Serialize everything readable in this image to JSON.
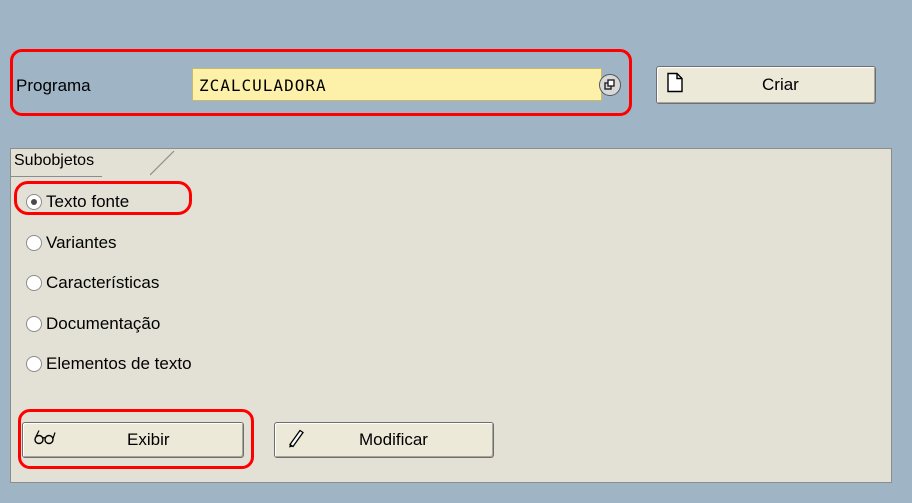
{
  "header": {
    "program_label": "Programa",
    "program_value": "ZCALCULADORA",
    "create_label": "Criar"
  },
  "subobjects": {
    "title": "Subobjetos",
    "options": [
      {
        "label": "Texto fonte",
        "selected": true
      },
      {
        "label": "Variantes",
        "selected": false
      },
      {
        "label": "Características",
        "selected": false
      },
      {
        "label": "Documentação",
        "selected": false
      },
      {
        "label": "Elementos de texto",
        "selected": false
      }
    ]
  },
  "actions": {
    "display_label": "Exibir",
    "modify_label": "Modificar"
  },
  "icons": {
    "create": "new-document-icon",
    "display": "glasses-icon",
    "modify": "pencil-icon",
    "search_help": "search-help-icon"
  },
  "colors": {
    "background": "#9fb4c5",
    "panel": "#e3e1d6",
    "input": "#fdf0a8",
    "highlight": "#ff0000"
  }
}
